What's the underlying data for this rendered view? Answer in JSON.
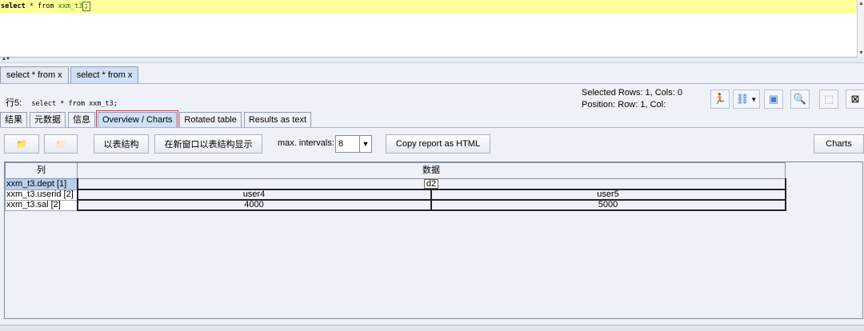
{
  "editor": {
    "sql_kw1": "select",
    "sql_mid": " * from ",
    "sql_table": "xxm_t3",
    "sql_end": ";"
  },
  "result_tabs": [
    {
      "label": "select * from x"
    },
    {
      "label": "select * from x"
    }
  ],
  "info": {
    "line_label": "行5:",
    "sql_text": "select * from xxm_t3;",
    "selected": "Selected Rows: 1, Cols: 0",
    "position": "Position: Row: 1, Col:"
  },
  "sub_tabs": [
    {
      "label": "结果"
    },
    {
      "label": "元数据"
    },
    {
      "label": "信息"
    },
    {
      "label": "Overview / Charts"
    },
    {
      "label": "Rotated table"
    },
    {
      "label": "Results as text"
    }
  ],
  "panel": {
    "show_structure": "以表结构",
    "show_structure_new": "在新窗口以表结构显示",
    "max_intervals_label": "max. intervals:",
    "max_intervals_value": "8",
    "copy_html": "Copy report as HTML",
    "charts": "Charts"
  },
  "table": {
    "col_header": "列",
    "data_header": "数据",
    "rows": [
      {
        "key": "xxm_t3.dept [1]",
        "values": [
          "d2"
        ]
      },
      {
        "key": "xxm_t3.userid [2]",
        "values": [
          "user4",
          "user5"
        ]
      },
      {
        "key": "xxm_t3.sal [2]",
        "values": [
          "4000",
          "5000"
        ]
      }
    ]
  },
  "icons": {
    "run": "running-man-icon",
    "tools": "binoculars-icon",
    "preview": "document-preview-icon",
    "search": "magnifier-icon",
    "window": "window-icon",
    "close": "close-icon"
  }
}
